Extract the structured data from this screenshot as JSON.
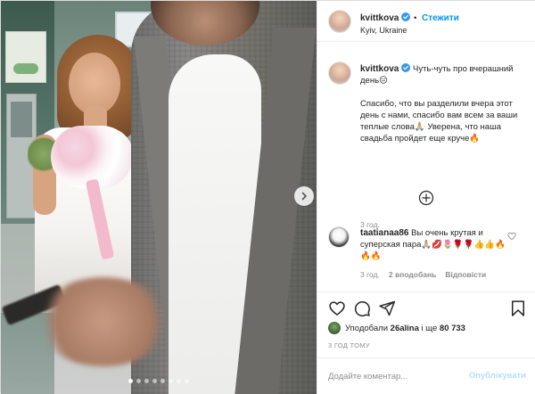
{
  "post": {
    "carousel": {
      "total_slides": 8,
      "active_slide": 1
    },
    "colors": {
      "accent": "#0095f6",
      "accent_disabled": "#b2dffc",
      "verified": "#3897f0",
      "muted": "#8e8e8e",
      "text": "#262626"
    }
  },
  "header": {
    "username": "kvittkova",
    "follow_label": "Стежити",
    "separator": "•",
    "location": "Kyiv, Ukraine"
  },
  "caption": {
    "username": "kvittkova",
    "lines": [
      "Чуть-чуть про вчерашний день😑",
      "",
      "Спасибо, что вы разделили вчера этот день с нами, спасибо вам всем за ваши теплые слова🙏🏼 Уверена, что наша свадьба пройдет еще круче🔥"
    ],
    "time": "3 год."
  },
  "load_more": {
    "icon": "plus-circle-icon"
  },
  "comments": [
    {
      "username": "taatianaa86",
      "text": "Вы очень крутая и суперская пара🙏🏼💋🌷🌹🌹👍👍🔥🔥🔥",
      "time": "3 год.",
      "likes": "2 вподобань",
      "reply": "Відповісти"
    }
  ],
  "actions": {
    "icons": [
      "heart-icon",
      "comment-icon",
      "share-icon",
      "bookmark-icon"
    ]
  },
  "likes": {
    "prefix": "Уподобали ",
    "user": "26alina",
    "middle": " і ще ",
    "count": "80 733"
  },
  "post_time": "3 ГОД ТОМУ",
  "add_comment": {
    "placeholder": "Додайте коментар...",
    "publish_label": "Опублікувати"
  }
}
